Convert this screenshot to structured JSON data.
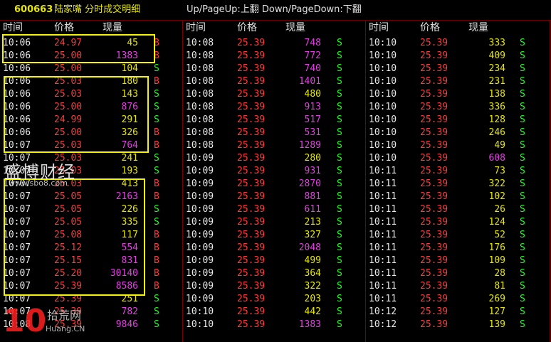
{
  "window": {
    "stock_code": "600663",
    "title": "陆家嘴 分时成交明细",
    "hint": "Up/PageUp:上翻 Down/PageDown:下翻"
  },
  "columns": {
    "time": "时间",
    "price": "价格",
    "volume": "现量"
  },
  "colors": {
    "up": "#ff3a3a",
    "flat": "#ffffff",
    "sell": "#22ff22",
    "buy": "#ff3a3a",
    "volume_yellow": "#e6e600",
    "volume_magenta": "#e040e0",
    "highlight": "#f5f500"
  },
  "panels": [
    {
      "rows": [
        {
          "time": "10:06",
          "price": "24.97",
          "vol": "45",
          "dir": "B",
          "pc": "up",
          "vc": "vy"
        },
        {
          "time": "10:06",
          "price": "25.00",
          "vol": "1383",
          "dir": "B",
          "pc": "up",
          "vc": "vm"
        },
        {
          "time": "10:06",
          "price": "25.00",
          "vol": "104",
          "dir": "S",
          "pc": "up",
          "vc": "vy"
        },
        {
          "time": "10:06",
          "price": "25.03",
          "vol": "180",
          "dir": "B",
          "pc": "up",
          "vc": "vy"
        },
        {
          "time": "10:06",
          "price": "25.03",
          "vol": "143",
          "dir": "S",
          "pc": "up",
          "vc": "vy"
        },
        {
          "time": "10:06",
          "price": "25.00",
          "vol": "876",
          "dir": "S",
          "pc": "up",
          "vc": "vm"
        },
        {
          "time": "10:06",
          "price": "24.99",
          "vol": "291",
          "dir": "S",
          "pc": "up",
          "vc": "vy"
        },
        {
          "time": "10:06",
          "price": "25.00",
          "vol": "326",
          "dir": "B",
          "pc": "up",
          "vc": "vy"
        },
        {
          "time": "10:07",
          "price": "25.03",
          "vol": "764",
          "dir": "B",
          "pc": "up",
          "vc": "vm"
        },
        {
          "time": "10:07",
          "price": "25.03",
          "vol": "241",
          "dir": "S",
          "pc": "up",
          "vc": "vy"
        },
        {
          "time": "10:07",
          "price": "25.03",
          "vol": "193",
          "dir": "S",
          "pc": "up",
          "vc": "vy"
        },
        {
          "time": "10:07",
          "price": "25.03",
          "vol": "413",
          "dir": "B",
          "pc": "up",
          "vc": "vy"
        },
        {
          "time": "10:07",
          "price": "25.05",
          "vol": "2163",
          "dir": "B",
          "pc": "up",
          "vc": "vm"
        },
        {
          "time": "10:07",
          "price": "25.05",
          "vol": "226",
          "dir": "S",
          "pc": "up",
          "vc": "vy"
        },
        {
          "time": "10:07",
          "price": "25.05",
          "vol": "335",
          "dir": "S",
          "pc": "up",
          "vc": "vy"
        },
        {
          "time": "10:07",
          "price": "25.08",
          "vol": "117",
          "dir": "B",
          "pc": "up",
          "vc": "vy"
        },
        {
          "time": "10:07",
          "price": "25.12",
          "vol": "554",
          "dir": "B",
          "pc": "up",
          "vc": "vm"
        },
        {
          "time": "10:07",
          "price": "25.15",
          "vol": "831",
          "dir": "B",
          "pc": "up",
          "vc": "vm"
        },
        {
          "time": "10:07",
          "price": "25.20",
          "vol": "30140",
          "dir": "B",
          "pc": "up",
          "vc": "vm"
        },
        {
          "time": "10:07",
          "price": "25.39",
          "vol": "8586",
          "dir": "B",
          "pc": "up",
          "vc": "vm"
        },
        {
          "time": "10:07",
          "price": "25.39",
          "vol": "251",
          "dir": "S",
          "pc": "up",
          "vc": "vy"
        },
        {
          "time": "10:07",
          "price": "25.39",
          "vol": "782",
          "dir": "S",
          "pc": "up",
          "vc": "vm"
        },
        {
          "time": "10:08",
          "price": "25.39",
          "vol": "9846",
          "dir": "S",
          "pc": "up",
          "vc": "vm"
        }
      ]
    },
    {
      "rows": [
        {
          "time": "10:08",
          "price": "25.39",
          "vol": "748",
          "dir": "S",
          "pc": "up",
          "vc": "vm"
        },
        {
          "time": "10:08",
          "price": "25.39",
          "vol": "772",
          "dir": "S",
          "pc": "up",
          "vc": "vm"
        },
        {
          "time": "10:08",
          "price": "25.39",
          "vol": "740",
          "dir": "S",
          "pc": "up",
          "vc": "vm"
        },
        {
          "time": "10:08",
          "price": "25.39",
          "vol": "1401",
          "dir": "S",
          "pc": "up",
          "vc": "vm"
        },
        {
          "time": "10:08",
          "price": "25.39",
          "vol": "480",
          "dir": "S",
          "pc": "up",
          "vc": "vy"
        },
        {
          "time": "10:08",
          "price": "25.39",
          "vol": "913",
          "dir": "S",
          "pc": "up",
          "vc": "vm"
        },
        {
          "time": "10:08",
          "price": "25.39",
          "vol": "517",
          "dir": "S",
          "pc": "up",
          "vc": "vm"
        },
        {
          "time": "10:08",
          "price": "25.39",
          "vol": "531",
          "dir": "S",
          "pc": "up",
          "vc": "vm"
        },
        {
          "time": "10:08",
          "price": "25.39",
          "vol": "1289",
          "dir": "S",
          "pc": "up",
          "vc": "vm"
        },
        {
          "time": "10:09",
          "price": "25.39",
          "vol": "280",
          "dir": "S",
          "pc": "up",
          "vc": "vy"
        },
        {
          "time": "10:09",
          "price": "25.39",
          "vol": "931",
          "dir": "S",
          "pc": "up",
          "vc": "vm"
        },
        {
          "time": "10:09",
          "price": "25.39",
          "vol": "2870",
          "dir": "S",
          "pc": "up",
          "vc": "vm"
        },
        {
          "time": "10:09",
          "price": "25.39",
          "vol": "881",
          "dir": "S",
          "pc": "up",
          "vc": "vm"
        },
        {
          "time": "10:09",
          "price": "25.39",
          "vol": "611",
          "dir": "S",
          "pc": "up",
          "vc": "vm"
        },
        {
          "time": "10:09",
          "price": "25.39",
          "vol": "213",
          "dir": "S",
          "pc": "up",
          "vc": "vy"
        },
        {
          "time": "10:09",
          "price": "25.39",
          "vol": "327",
          "dir": "S",
          "pc": "up",
          "vc": "vy"
        },
        {
          "time": "10:09",
          "price": "25.39",
          "vol": "2048",
          "dir": "S",
          "pc": "up",
          "vc": "vm"
        },
        {
          "time": "10:09",
          "price": "25.39",
          "vol": "499",
          "dir": "S",
          "pc": "up",
          "vc": "vy"
        },
        {
          "time": "10:09",
          "price": "25.39",
          "vol": "364",
          "dir": "S",
          "pc": "up",
          "vc": "vy"
        },
        {
          "time": "10:09",
          "price": "25.39",
          "vol": "322",
          "dir": "S",
          "pc": "up",
          "vc": "vy"
        },
        {
          "time": "10:09",
          "price": "25.39",
          "vol": "203",
          "dir": "S",
          "pc": "up",
          "vc": "vy"
        },
        {
          "time": "10:10",
          "price": "25.39",
          "vol": "442",
          "dir": "S",
          "pc": "up",
          "vc": "vy"
        },
        {
          "time": "10:10",
          "price": "25.39",
          "vol": "1383",
          "dir": "S",
          "pc": "up",
          "vc": "vm"
        }
      ]
    },
    {
      "rows": [
        {
          "time": "10:10",
          "price": "25.39",
          "vol": "333",
          "dir": "S",
          "pc": "up",
          "vc": "vy"
        },
        {
          "time": "10:10",
          "price": "25.39",
          "vol": "409",
          "dir": "S",
          "pc": "up",
          "vc": "vy"
        },
        {
          "time": "10:10",
          "price": "25.39",
          "vol": "234",
          "dir": "S",
          "pc": "up",
          "vc": "vy"
        },
        {
          "time": "10:10",
          "price": "25.39",
          "vol": "231",
          "dir": "S",
          "pc": "up",
          "vc": "vy"
        },
        {
          "time": "10:10",
          "price": "25.39",
          "vol": "138",
          "dir": "S",
          "pc": "up",
          "vc": "vy"
        },
        {
          "time": "10:10",
          "price": "25.39",
          "vol": "336",
          "dir": "S",
          "pc": "up",
          "vc": "vy"
        },
        {
          "time": "10:10",
          "price": "25.39",
          "vol": "128",
          "dir": "S",
          "pc": "up",
          "vc": "vy"
        },
        {
          "time": "10:10",
          "price": "25.39",
          "vol": "246",
          "dir": "S",
          "pc": "up",
          "vc": "vy"
        },
        {
          "time": "10:10",
          "price": "25.39",
          "vol": "49",
          "dir": "S",
          "pc": "up",
          "vc": "vy"
        },
        {
          "time": "10:10",
          "price": "25.39",
          "vol": "608",
          "dir": "S",
          "pc": "up",
          "vc": "vm"
        },
        {
          "time": "10:11",
          "price": "25.39",
          "vol": "73",
          "dir": "S",
          "pc": "up",
          "vc": "vy"
        },
        {
          "time": "10:11",
          "price": "25.39",
          "vol": "322",
          "dir": "S",
          "pc": "up",
          "vc": "vy"
        },
        {
          "time": "10:11",
          "price": "25.39",
          "vol": "102",
          "dir": "S",
          "pc": "up",
          "vc": "vy"
        },
        {
          "time": "10:11",
          "price": "25.39",
          "vol": "26",
          "dir": "S",
          "pc": "up",
          "vc": "vy"
        },
        {
          "time": "10:11",
          "price": "25.39",
          "vol": "124",
          "dir": "S",
          "pc": "up",
          "vc": "vy"
        },
        {
          "time": "10:11",
          "price": "25.39",
          "vol": "52",
          "dir": "S",
          "pc": "up",
          "vc": "vy"
        },
        {
          "time": "10:11",
          "price": "25.39",
          "vol": "176",
          "dir": "S",
          "pc": "up",
          "vc": "vy"
        },
        {
          "time": "10:11",
          "price": "25.39",
          "vol": "109",
          "dir": "S",
          "pc": "up",
          "vc": "vy"
        },
        {
          "time": "10:11",
          "price": "25.39",
          "vol": "28",
          "dir": "S",
          "pc": "up",
          "vc": "vy"
        },
        {
          "time": "10:11",
          "price": "25.39",
          "vol": "81",
          "dir": "S",
          "pc": "up",
          "vc": "vy"
        },
        {
          "time": "10:11",
          "price": "25.39",
          "vol": "269",
          "dir": "S",
          "pc": "up",
          "vc": "vy"
        },
        {
          "time": "10:12",
          "price": "25.39",
          "vol": "127",
          "dir": "S",
          "pc": "up",
          "vc": "vy"
        },
        {
          "time": "10:12",
          "price": "25.39",
          "vol": "139",
          "dir": "S",
          "pc": "up",
          "vc": "vy"
        }
      ]
    }
  ],
  "watermarks": {
    "brand_cn": "盛博财经",
    "brand_url": "www.sbo8.com",
    "logo_number": "10",
    "logo_cn": "拾荒网",
    "logo_url": "Huang.CN"
  }
}
